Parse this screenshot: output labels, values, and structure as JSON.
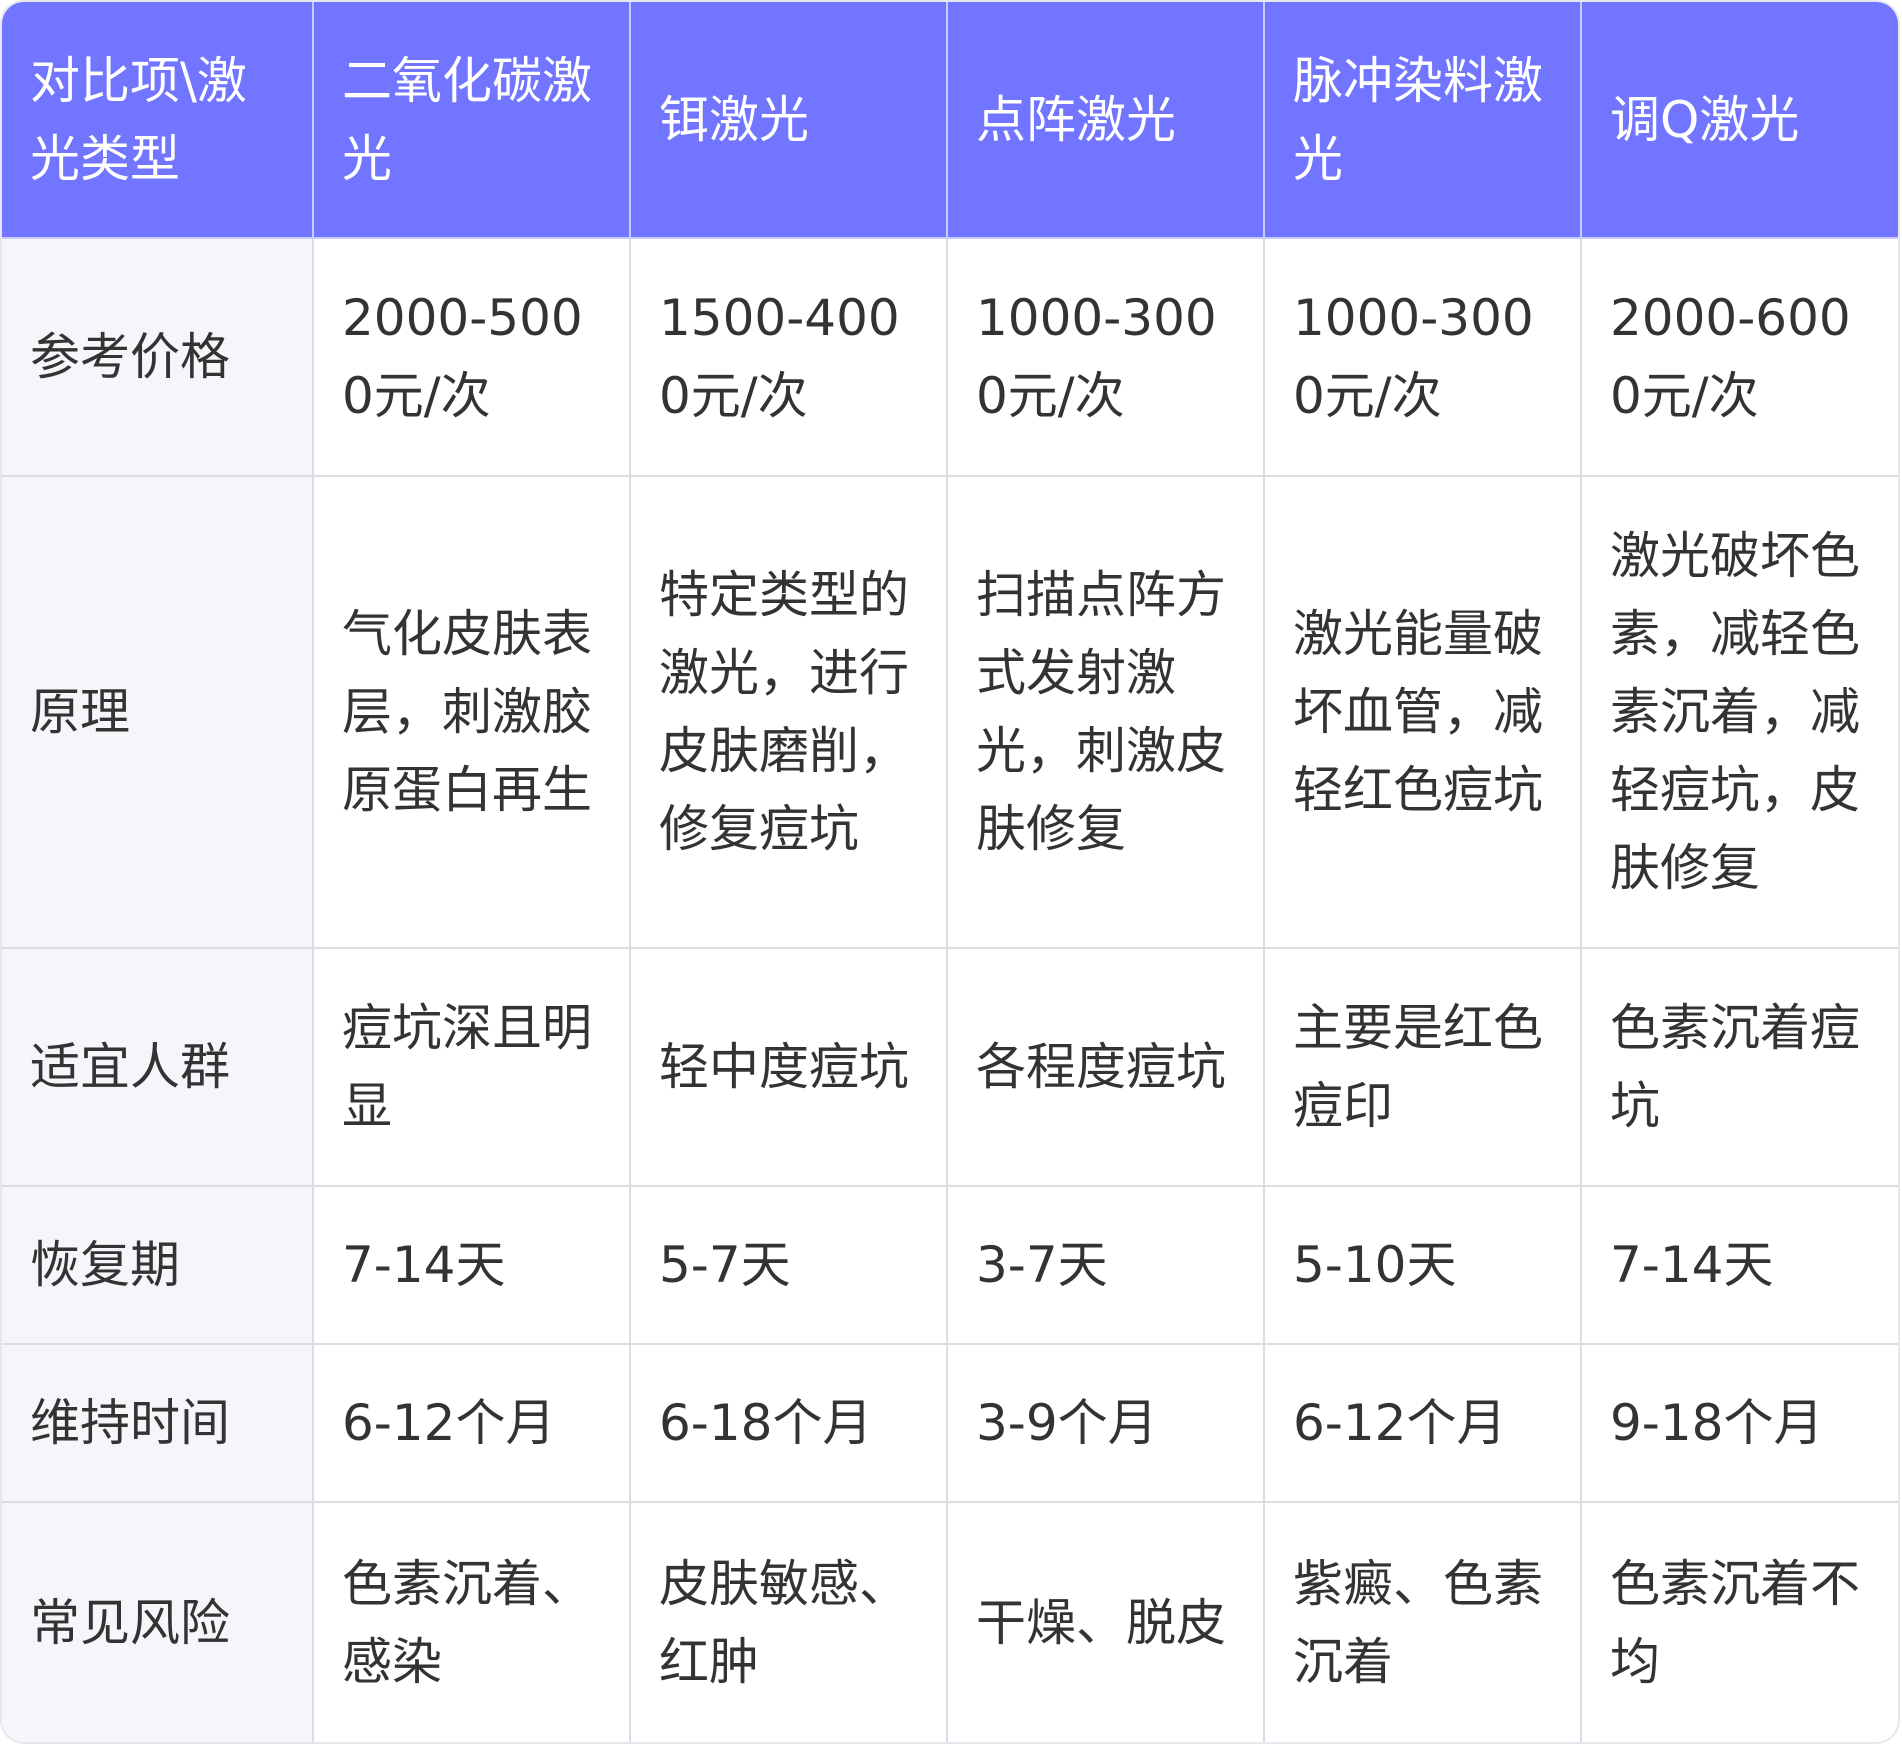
{
  "colors": {
    "header_bg": "#7175ff",
    "header_text": "#ffffff",
    "label_col_bg": "#f5f6fa",
    "cell_bg": "#ffffff",
    "border": "#dcdde3",
    "text": "#333333"
  },
  "header": [
    "对比项\\激光类型",
    "二氧化碳激光",
    "铒激光",
    "点阵激光",
    "脉冲染料激光",
    "调Q激光"
  ],
  "rows": [
    {
      "label": "参考价格",
      "cells": [
        "2000-5000元/次",
        "1500-4000元/次",
        "1000-3000元/次",
        "1000-3000元/次",
        "2000-6000元/次"
      ]
    },
    {
      "label": "原理",
      "cells": [
        "气化皮肤表层，刺激胶原蛋白再生",
        "特定类型的激光，进行皮肤磨削，修复痘坑",
        "扫描点阵方式发射激光，刺激皮肤修复",
        "激光能量破坏血管，减轻红色痘坑",
        "激光破坏色素，减轻色素沉着，减轻痘坑，皮肤修复"
      ]
    },
    {
      "label": "适宜人群",
      "cells": [
        "痘坑深且明显",
        "轻中度痘坑",
        "各程度痘坑",
        "主要是红色痘印",
        "色素沉着痘坑"
      ]
    },
    {
      "label": "恢复期",
      "cells": [
        "7-14天",
        "5-7天",
        "3-7天",
        "5-10天",
        "7-14天"
      ]
    },
    {
      "label": "维持时间",
      "cells": [
        "6-12个月",
        "6-18个月",
        "3-9个月",
        "6-12个月",
        "9-18个月"
      ]
    },
    {
      "label": "常见风险",
      "cells": [
        "色素沉着、感染",
        "皮肤敏感、红肿",
        "干燥、脱皮",
        "紫癜、色素沉着",
        "色素沉着不均"
      ]
    }
  ]
}
